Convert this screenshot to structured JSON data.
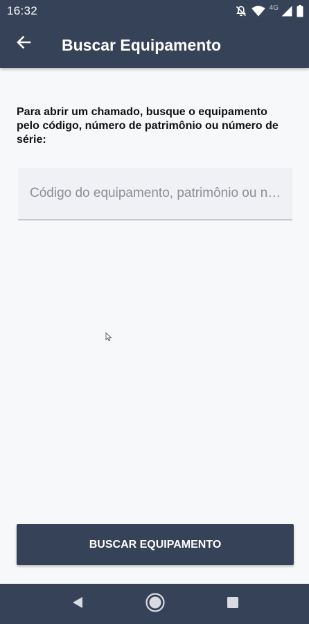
{
  "status_bar": {
    "time": "16:32",
    "network_label": "4G",
    "icons": [
      "notifications-off-icon",
      "wifi-icon",
      "cellular-signal-icon",
      "battery-icon"
    ]
  },
  "app_bar": {
    "title": "Buscar Equipamento",
    "back_icon": "arrow-left-icon"
  },
  "main": {
    "instruction": "Para abrir um chamado, busque o equipamento pelo código, número de patrimônio ou número de série:",
    "search": {
      "placeholder": "Código do equipamento, patrimônio ou número de série",
      "value": ""
    },
    "button_label": "BUSCAR EQUIPAMENTO"
  },
  "nav_bar": {
    "icons": [
      "nav-back-icon",
      "nav-home-icon",
      "nav-recents-icon"
    ]
  },
  "colors": {
    "primary": "#364257",
    "background": "#f7f8fa",
    "field_background": "#f0f1f4"
  }
}
